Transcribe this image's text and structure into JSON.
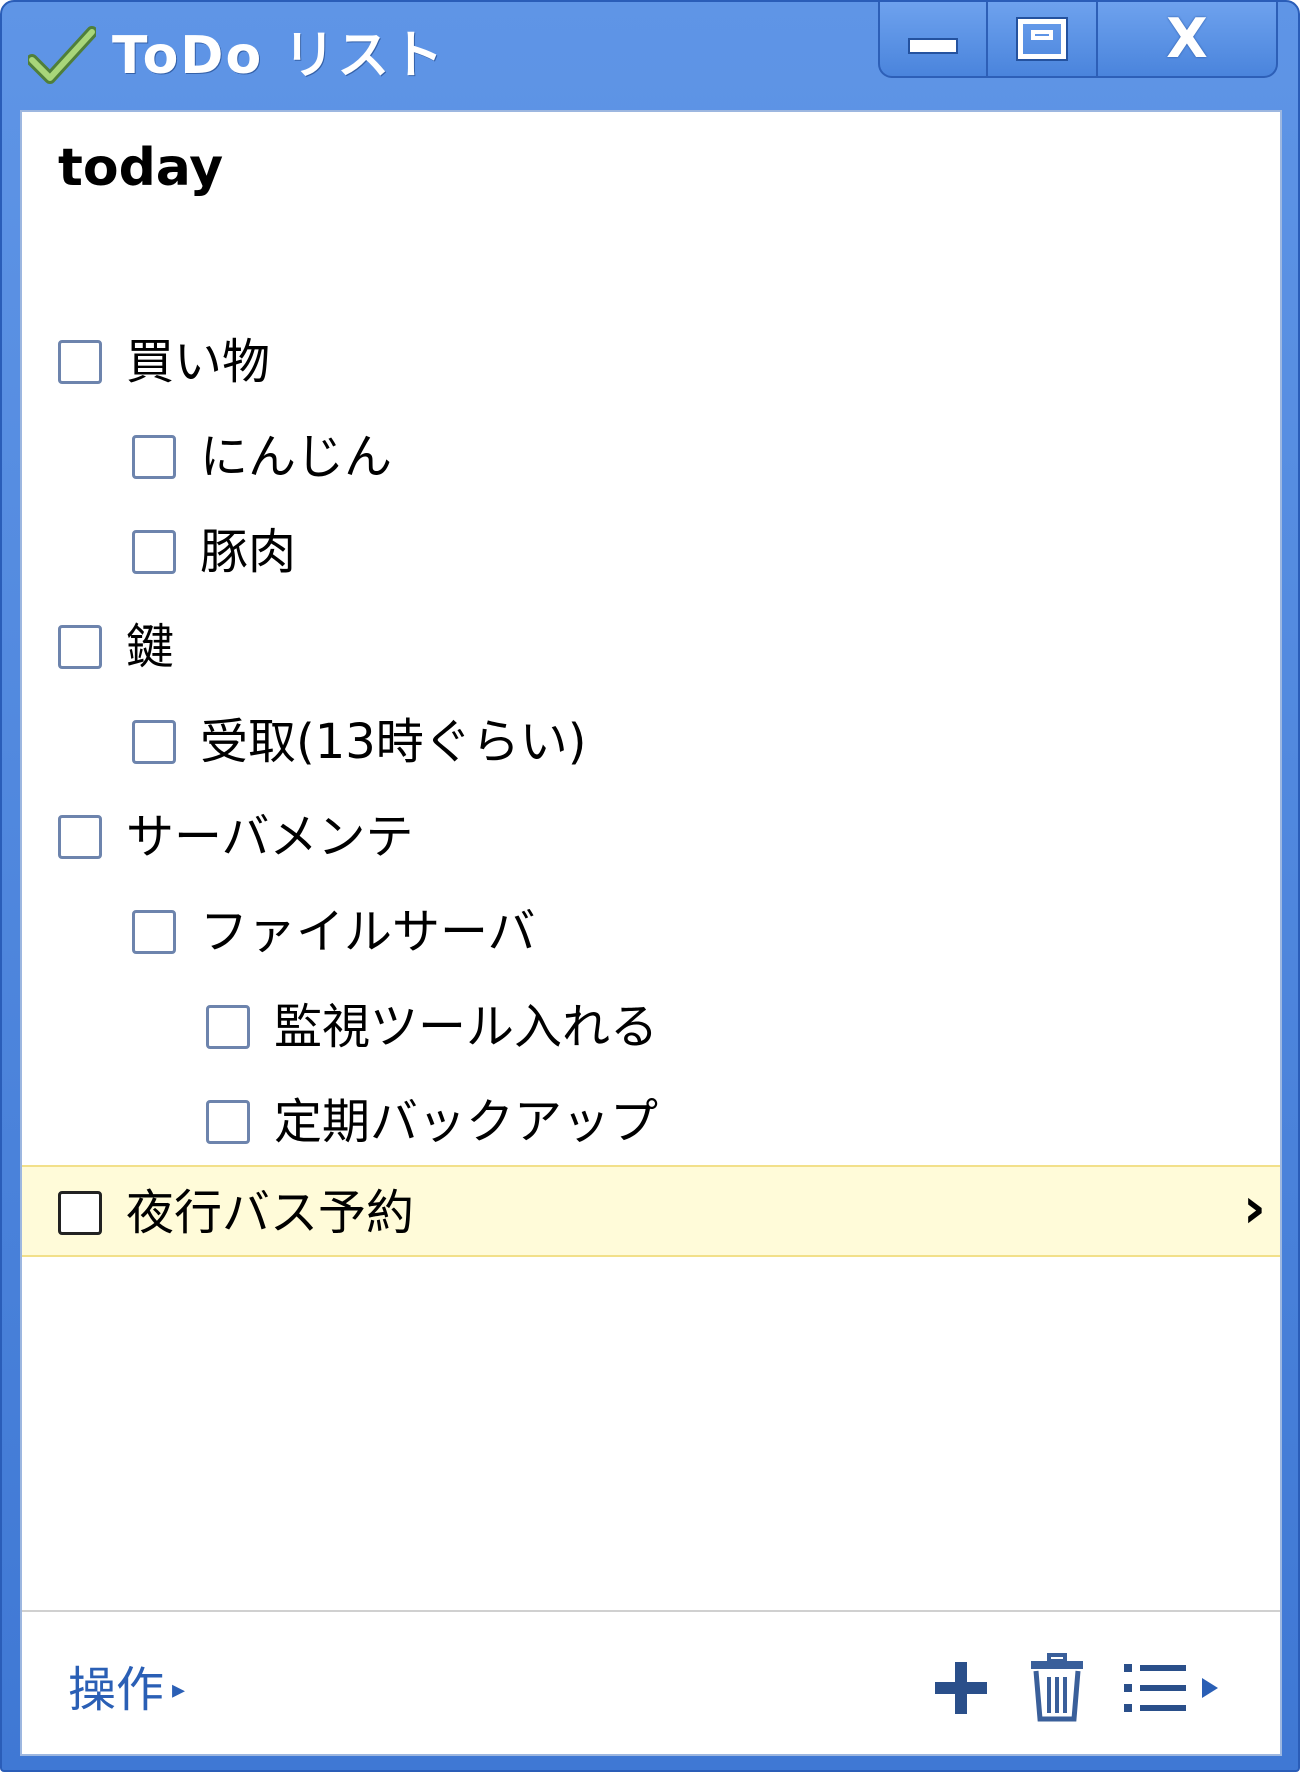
{
  "window": {
    "title": "ToDo リスト",
    "close_label": "X"
  },
  "list": {
    "title": "today",
    "tasks": [
      {
        "label": "買い物",
        "level": 0
      },
      {
        "label": "にんじん",
        "level": 1
      },
      {
        "label": "豚肉",
        "level": 1
      },
      {
        "label": "鍵",
        "level": 0
      },
      {
        "label": "受取(13時ぐらい)",
        "level": 1
      },
      {
        "label": "サーバメンテ",
        "level": 0
      },
      {
        "label": "ファイルサーバ",
        "level": 1
      },
      {
        "label": "監視ツール入れる",
        "level": 2
      },
      {
        "label": "定期バックアップ",
        "level": 2
      },
      {
        "label": "夜行バス予約",
        "level": 0,
        "selected": true
      }
    ],
    "chevron": "›"
  },
  "footer": {
    "actions_label": "操作",
    "actions_arrow": "▸",
    "add_icon": "plus-icon",
    "delete_icon": "trash-icon",
    "list_menu_icon": "list-icon",
    "list_menu_arrow": "▸"
  },
  "colors": {
    "titlebar": "#4a84dc",
    "link": "#2a5fb5",
    "selected_row": "#fffbd9"
  }
}
